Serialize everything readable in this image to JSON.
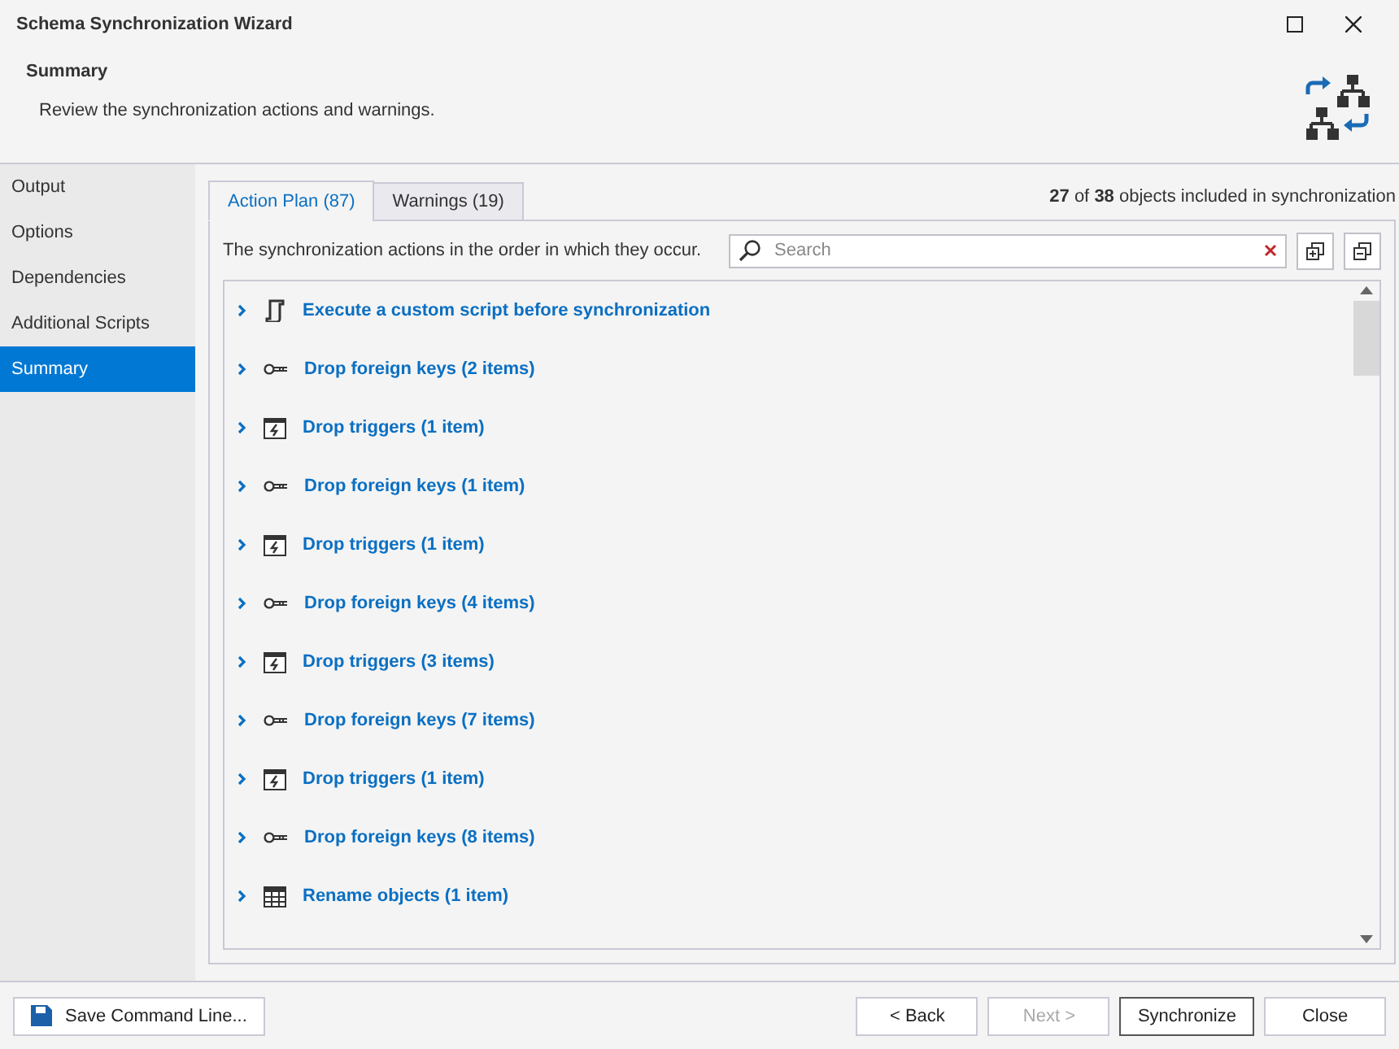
{
  "window": {
    "title": "Schema Synchronization Wizard"
  },
  "header": {
    "title": "Summary",
    "subtitle": "Review the synchronization actions and warnings."
  },
  "sidebar": {
    "items": [
      {
        "label": "Output",
        "selected": false
      },
      {
        "label": "Options",
        "selected": false
      },
      {
        "label": "Dependencies",
        "selected": false
      },
      {
        "label": "Additional Scripts",
        "selected": false
      },
      {
        "label": "Summary",
        "selected": true
      }
    ]
  },
  "tabs": [
    {
      "label": "Action Plan (87)",
      "selected": true
    },
    {
      "label": "Warnings (19)",
      "selected": false
    }
  ],
  "included": {
    "count": "27",
    "of": "of",
    "total": "38",
    "text": "objects included in synchronization"
  },
  "description": "The synchronization actions in the order in which they occur.",
  "search": {
    "placeholder": "Search"
  },
  "actions": [
    {
      "kind": "script",
      "label": "Execute a custom script before synchronization"
    },
    {
      "kind": "key",
      "label": "Drop foreign keys (2 items)"
    },
    {
      "kind": "trigger",
      "label": "Drop triggers (1 item)"
    },
    {
      "kind": "key",
      "label": "Drop foreign keys (1 item)"
    },
    {
      "kind": "trigger",
      "label": "Drop triggers (1 item)"
    },
    {
      "kind": "key",
      "label": "Drop foreign keys (4 items)"
    },
    {
      "kind": "trigger",
      "label": "Drop triggers (3 items)"
    },
    {
      "kind": "key",
      "label": "Drop foreign keys (7 items)"
    },
    {
      "kind": "trigger",
      "label": "Drop triggers (1 item)"
    },
    {
      "kind": "key",
      "label": "Drop foreign keys (8 items)"
    },
    {
      "kind": "table",
      "label": "Rename objects (1 item)"
    }
  ],
  "footer": {
    "save": "Save Command Line...",
    "buttons": [
      {
        "label": "< Back",
        "disabled": false,
        "default": false
      },
      {
        "label": "Next >",
        "disabled": true,
        "default": false
      },
      {
        "label": "Synchronize",
        "disabled": false,
        "default": true
      },
      {
        "label": "Close",
        "disabled": false,
        "default": false
      }
    ]
  }
}
